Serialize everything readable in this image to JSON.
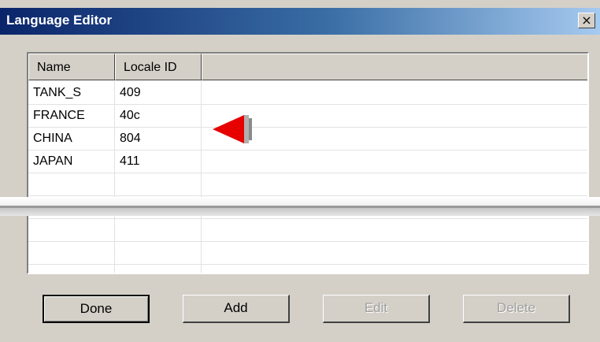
{
  "window": {
    "title": "Language Editor",
    "close_label": "×"
  },
  "table": {
    "columns": [
      "Name",
      "Locale ID",
      ""
    ],
    "rows": [
      {
        "name": "TANK_S",
        "locale_id": "409"
      },
      {
        "name": "FRANCE",
        "locale_id": "40c"
      },
      {
        "name": "CHINA",
        "locale_id": "804"
      },
      {
        "name": "JAPAN",
        "locale_id": "411"
      }
    ]
  },
  "buttons": {
    "done": "Done",
    "add": "Add",
    "edit": "Edit",
    "delete": "Delete"
  },
  "colors": {
    "title_bar": "#0a246a",
    "pointer_arrow": "#e60000",
    "face": "#d4d0c8"
  },
  "icons": {
    "pointer": "red-arrow-left-icon"
  }
}
